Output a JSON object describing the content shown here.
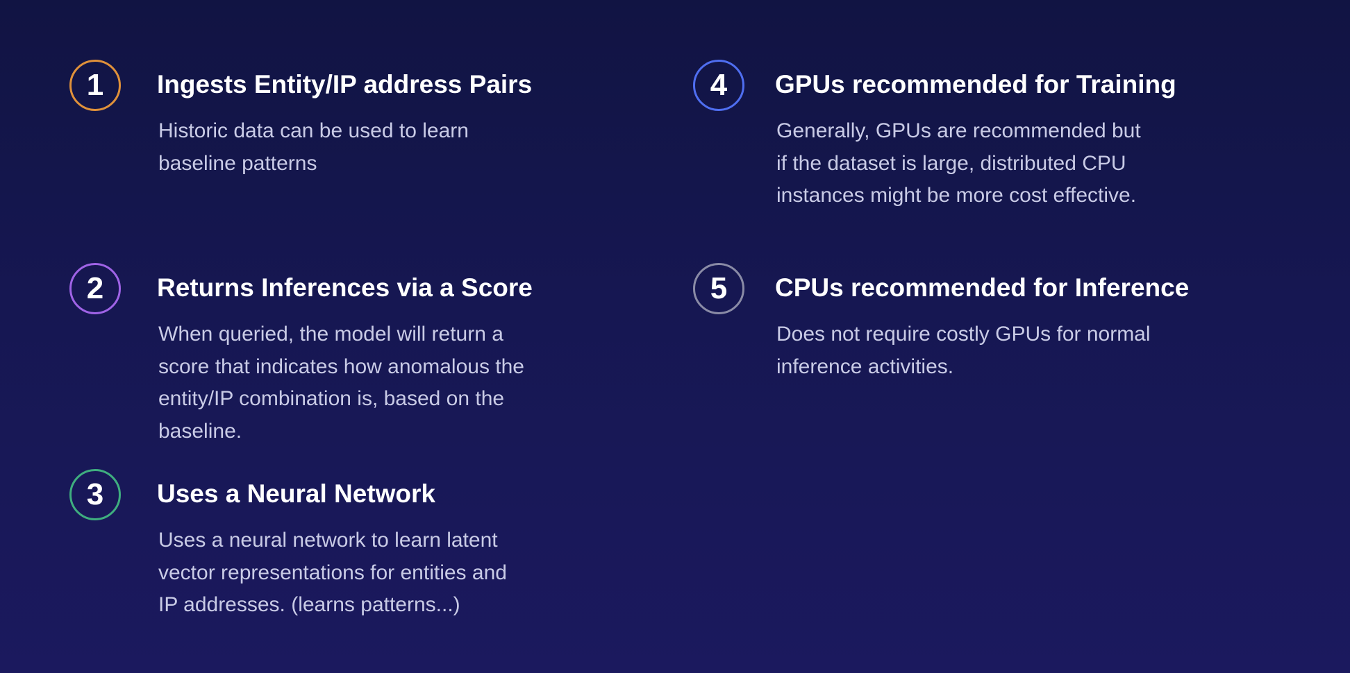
{
  "items": [
    {
      "number": "1",
      "color": "#e0913a",
      "title": "Ingests Entity/IP address Pairs",
      "lines": [
        "Historic data can be used to learn",
        "baseline patterns"
      ]
    },
    {
      "number": "2",
      "color": "#9f63e6",
      "title": "Returns Inferences via a Score",
      "lines": [
        "When queried, the model will return a",
        "score that indicates how anomalous the",
        "entity/IP combination is, based on the",
        "baseline."
      ]
    },
    {
      "number": "3",
      "color": "#3fae7f",
      "title": "Uses a Neural Network",
      "lines": [
        "Uses a neural network to learn latent",
        "vector representations for entities and",
        "IP addresses.  (learns patterns...)"
      ]
    },
    {
      "number": "4",
      "color": "#4f6ef0",
      "title": "GPUs recommended for Training",
      "lines": [
        "Generally, GPUs are recommended but",
        "if the dataset is large, distributed CPU",
        "instances might be more cost effective."
      ]
    },
    {
      "number": "5",
      "color": "#8a8ba6",
      "title": "CPUs recommended for Inference",
      "lines": [
        "Does not require costly GPUs for normal",
        "inference activities."
      ]
    }
  ]
}
